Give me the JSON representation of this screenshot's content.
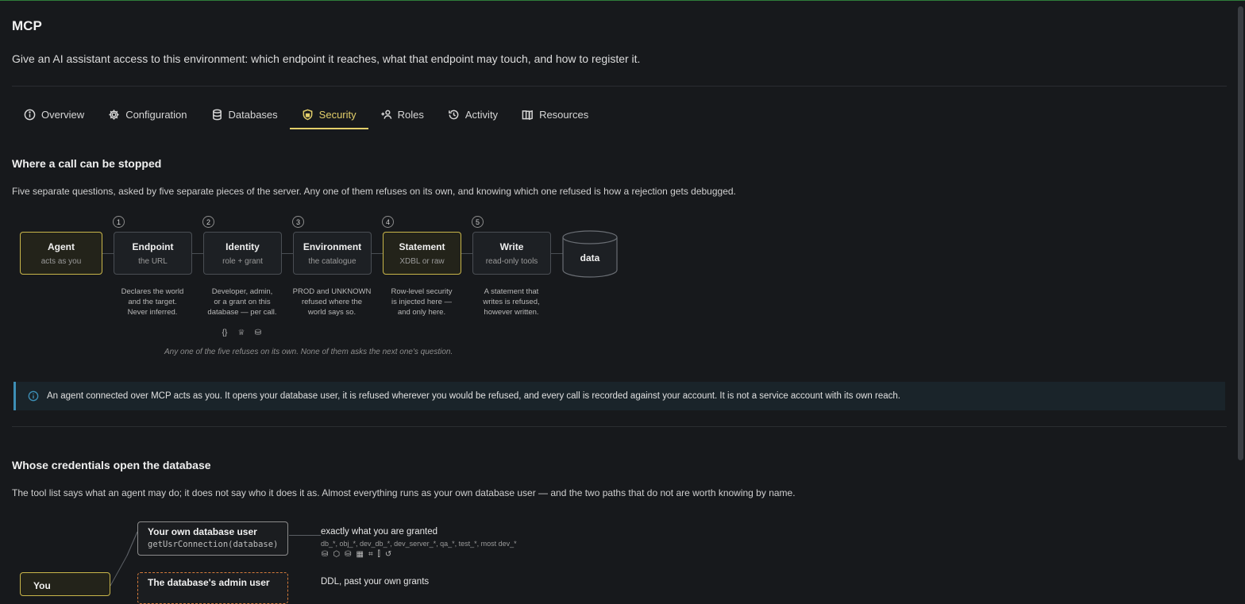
{
  "header": {
    "title": "MCP",
    "subtitle": "Give an AI assistant access to this environment: which endpoint it reaches, what that endpoint may touch, and how to register it."
  },
  "tabs": [
    {
      "label": "Overview",
      "icon": "info-icon"
    },
    {
      "label": "Configuration",
      "icon": "gear-icon"
    },
    {
      "label": "Databases",
      "icon": "database-icon"
    },
    {
      "label": "Security",
      "icon": "shield-icon",
      "active": true
    },
    {
      "label": "Roles",
      "icon": "roles-icon"
    },
    {
      "label": "Activity",
      "icon": "history-icon"
    },
    {
      "label": "Resources",
      "icon": "book-icon"
    }
  ],
  "section1": {
    "title": "Where a call can be stopped",
    "description": "Five separate questions, asked by five separate pieces of the server. Any one of them refuses on its own, and knowing which one refused is how a rejection gets debugged.",
    "nodes": [
      {
        "title": "Agent",
        "sub": "acts as you",
        "highlight": true
      },
      {
        "step": "1",
        "title": "Endpoint",
        "sub": "the URL",
        "desc": [
          "Declares the world",
          "and the target.",
          "Never inferred."
        ]
      },
      {
        "step": "2",
        "title": "Identity",
        "sub": "role + grant",
        "desc": [
          "Developer, admin,",
          "or a grant on this",
          "database — per call."
        ]
      },
      {
        "step": "3",
        "title": "Environment",
        "sub": "the catalogue",
        "desc": [
          "PROD and UNKNOWN",
          "refused where the",
          "world says so."
        ]
      },
      {
        "step": "4",
        "title": "Statement",
        "sub": "XDBL or raw",
        "highlight": true,
        "desc": [
          "Row-level security",
          "is injected here —",
          "and only here."
        ]
      },
      {
        "step": "5",
        "title": "Write",
        "sub": "read-only tools",
        "desc": [
          "A statement that",
          "writes is refused,",
          "however written."
        ]
      }
    ],
    "data_label": "data",
    "identity_icons": [
      "{}",
      "crown-icon",
      "database-lock-icon"
    ],
    "caption": "Any one of the five refuses on its own. None of them asks the next one's question."
  },
  "callout": {
    "icon": "info-icon",
    "text": "An agent connected over MCP acts as you. It opens your database user, it is refused wherever you would be refused, and every call is recorded against your account. It is not a service account with its own reach."
  },
  "section2": {
    "title": "Whose credentials open the database",
    "description": "The tool list says what an agent may do; it does not say who it does it as. Almost everything runs as your own database user — and the two paths that do not are worth knowing by name.",
    "you_label": "You ",
    "paths": [
      {
        "title": "Your own database user",
        "code": "getUsrConnection(database)",
        "result": "exactly what you are granted",
        "scope": "db_*, obj_*, dev_db_*, dev_server_*, qa_*, test_*, most dev_*",
        "icons": [
          "database-search-icon",
          "cube-icon",
          "database-lock-icon",
          "image-icon",
          "scan-icon",
          "tube-icon",
          "history-icon"
        ]
      },
      {
        "title": "The database's admin user",
        "result": "DDL, past your own grants"
      }
    ]
  },
  "colors": {
    "accent": "#e3cf6a",
    "info": "#3d8fb6",
    "admin_dashed": "#d47a3a"
  }
}
